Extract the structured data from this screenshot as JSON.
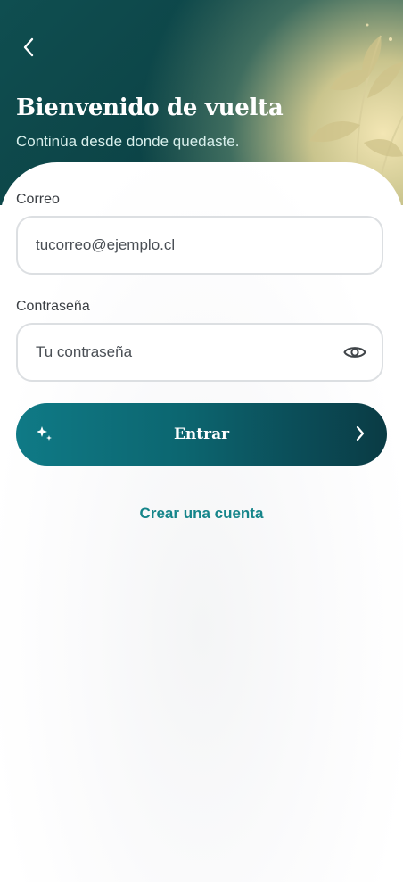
{
  "header": {
    "title": "Bienvenido de vuelta",
    "subtitle": "Continúa desde donde quedaste.",
    "back_icon": "chevron-left-icon"
  },
  "form": {
    "email_label": "Correo",
    "email_placeholder": "tucorreo@ejemplo.cl",
    "password_label": "Contraseña",
    "password_placeholder": "Tu contraseña",
    "password_toggle_icon": "eye-icon"
  },
  "actions": {
    "submit_label": "Entrar",
    "submit_left_icon": "sparkle-icon",
    "submit_right_icon": "chevron-right-icon",
    "create_account_label": "Crear una cuenta"
  },
  "colors": {
    "header_bg": "#0f4e50",
    "button_start": "#0f7a86",
    "button_end": "#0a3b44",
    "link": "#15858a"
  }
}
